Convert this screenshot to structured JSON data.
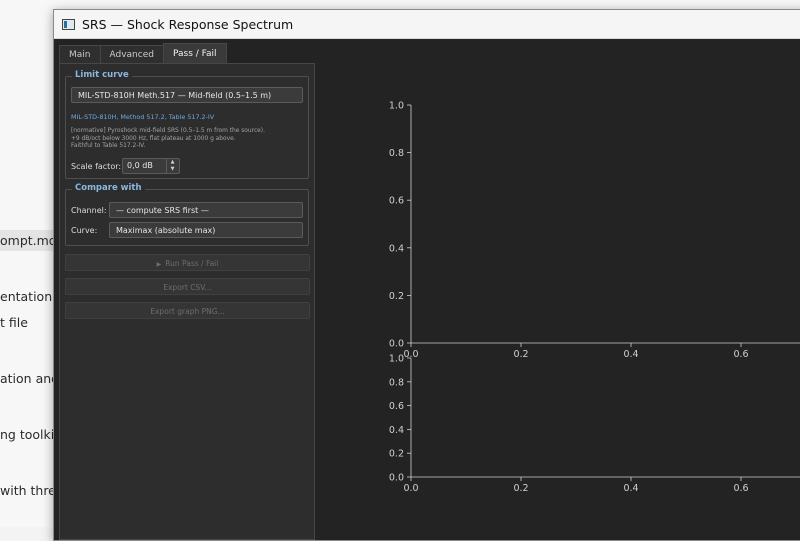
{
  "background_doc": {
    "lines": [
      "ompt.md f",
      "entation",
      "t file",
      "ation and",
      "ng toolkit",
      "with thre"
    ]
  },
  "window": {
    "title": "SRS — Shock Response Spectrum",
    "icon": "app-window-icon"
  },
  "tabs": [
    {
      "label": "Main",
      "active": false
    },
    {
      "label": "Advanced",
      "active": false
    },
    {
      "label": "Pass / Fail",
      "active": true
    }
  ],
  "limit_curve": {
    "group_title": "Limit curve",
    "selected": "MIL-STD-810H Meth.517 — Mid-field (0.5–1.5 m)",
    "standard_ref": "MIL-STD-810H, Method 517.2, Table 517.2-IV",
    "description": [
      "[normative] Pyroshock mid-field SRS (0.5–1.5 m from the source).",
      "+9 dB/oct below 3000 Hz, flat plateau at 1000 g above.",
      "Faithful to Table 517.2-IV."
    ],
    "scale_label": "Scale factor:",
    "scale_value": "0,0 dB"
  },
  "compare": {
    "group_title": "Compare with",
    "channel_label": "Channel:",
    "channel_value": "— compute SRS first —",
    "curve_label": "Curve:",
    "curve_value": "Maximax (absolute max)"
  },
  "buttons": {
    "run": "Run Pass / Fail",
    "export_csv": "Export CSV...",
    "export_png": "Export graph PNG..."
  },
  "colors": {
    "accent": "#89b8e0",
    "link": "#6ea8dc",
    "plot_bg": "#232323",
    "axis": "#cfcfcf"
  },
  "chart_data": [
    {
      "type": "line",
      "title": "",
      "xlabel": "",
      "ylabel": "",
      "xlim": [
        0,
        1
      ],
      "ylim": [
        0,
        1
      ],
      "xticks": [
        "0.0",
        "0.2",
        "0.4",
        "0.6"
      ],
      "yticks": [
        "0.0",
        "0.2",
        "0.4",
        "0.6",
        "0.8",
        "1.0"
      ],
      "grid": false,
      "series": []
    },
    {
      "type": "line",
      "title": "",
      "xlabel": "",
      "ylabel": "",
      "xlim": [
        0,
        1
      ],
      "ylim": [
        0,
        1
      ],
      "xticks": [
        "0.0",
        "0.2",
        "0.4",
        "0.6"
      ],
      "yticks": [
        "0.0",
        "0.2",
        "0.4",
        "0.6",
        "0.8",
        "1.0"
      ],
      "grid": false,
      "series": []
    }
  ]
}
